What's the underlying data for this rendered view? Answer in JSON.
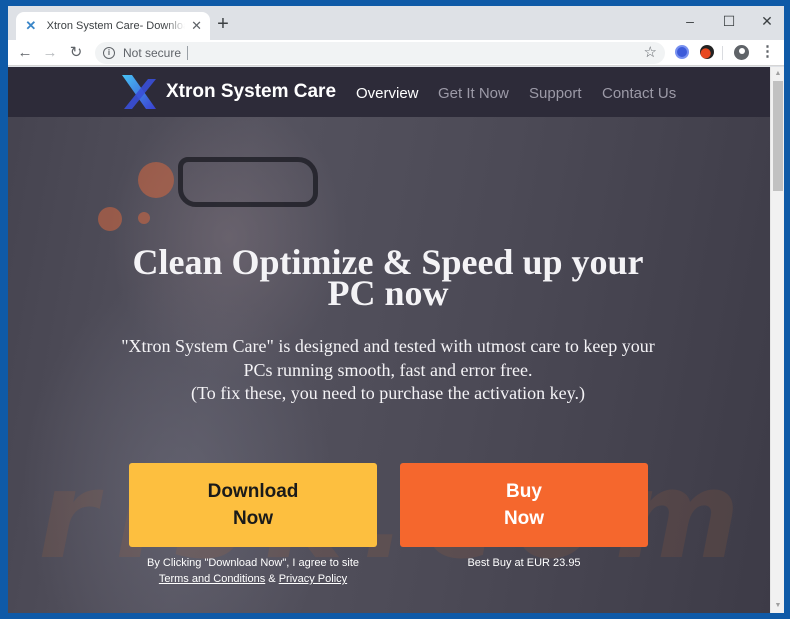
{
  "browser": {
    "tab_title": "Xtron System Care- Download PC",
    "tab_close": "✕",
    "new_tab": "+",
    "window_controls": {
      "minimize": "–",
      "maximize": "☐",
      "close": "✕"
    },
    "nav": {
      "back": "←",
      "forward": "→",
      "reload": "↻"
    },
    "security_label": "Not secure",
    "address": "",
    "star": "☆",
    "menu": "⋮"
  },
  "site": {
    "brand": "Xtron System Care",
    "nav": [
      {
        "label": "Overview",
        "active": true
      },
      {
        "label": "Get It Now",
        "active": false
      },
      {
        "label": "Support",
        "active": false
      },
      {
        "label": "Contact Us",
        "active": false
      }
    ],
    "headline_line1": "Clean Optimize & Speed up your",
    "headline_line2": "PC now",
    "desc_line1": "\"Xtron System Care\" is designed and tested with utmost care to keep your",
    "desc_line2": "PCs running smooth, fast and error free.",
    "desc_line3": "(To fix these, you need to purchase the activation key.)",
    "download_button": {
      "line1": "Download",
      "line2": "Now"
    },
    "buy_button": {
      "line1": "Buy",
      "line2": "Now"
    },
    "download_note": {
      "line1": "By Clicking \"Download Now\", I agree to site",
      "terms": "Terms and Conditions",
      "amp": " & ",
      "privacy": "Privacy Policy"
    },
    "buy_note": "Best Buy at EUR 23.95",
    "watermark": "risk.com"
  },
  "colors": {
    "download_button": "#fdbf3f",
    "buy_button": "#f5672d",
    "nav_bar": "#2d2b39"
  }
}
